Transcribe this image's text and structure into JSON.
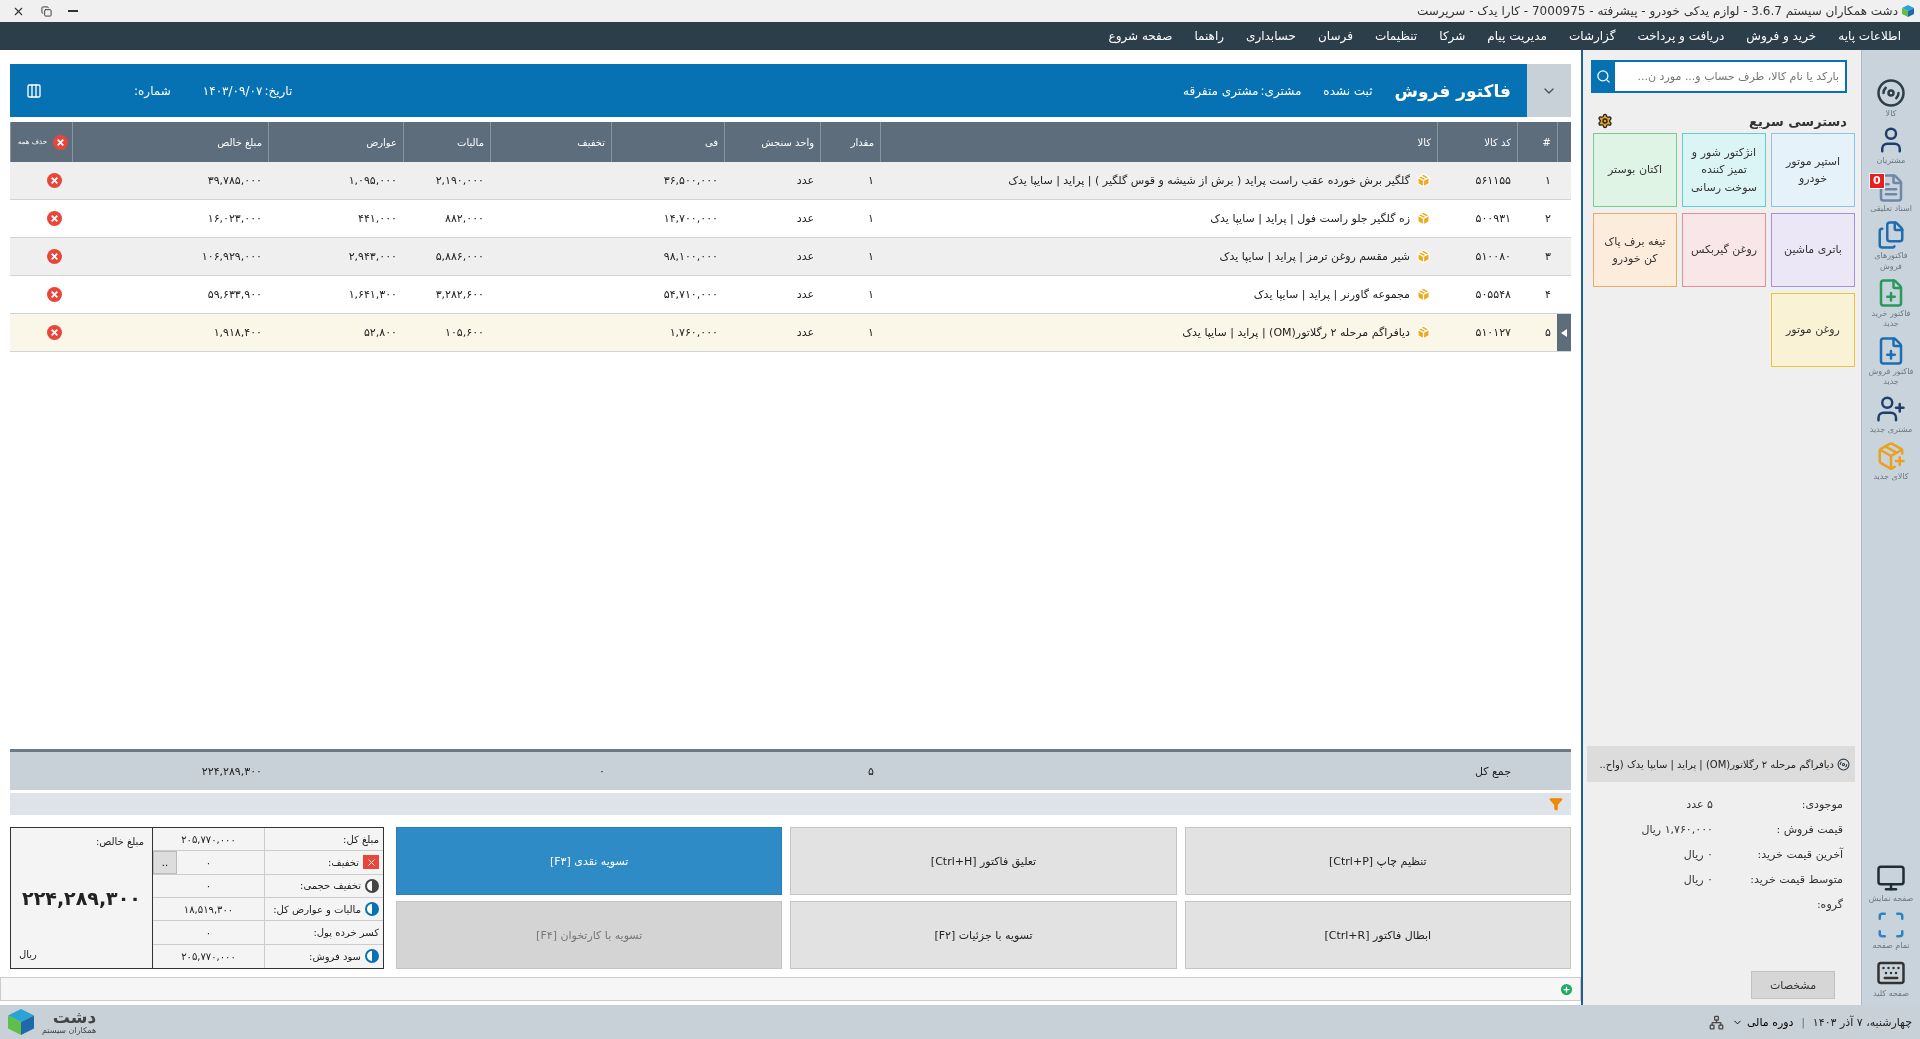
{
  "window": {
    "title": "دشت همکاران سیستم 3.6.7 - لوازم یدکی خودرو - پیشرفته - 7000975 - کارا یدک - سرپرست"
  },
  "menu": [
    "اطلاعات پایه",
    "خرید و فروش",
    "دریافت و پرداخت",
    "گزارشات",
    "مدیریت پیام",
    "شرکا",
    "تنظیمات",
    "فرسان",
    "حسابداری",
    "راهنما",
    "صفحه شروع"
  ],
  "invoice": {
    "title": "فاکتور فروش",
    "status": "ثبت نشده",
    "customer_label": "مشتری:",
    "customer": "مشتری متفرقه",
    "date_label": "تاریخ:",
    "date": "۱۴۰۳/۰۹/۰۷",
    "number_label": "شماره:"
  },
  "table": {
    "columns": [
      "#",
      "کد کالا",
      "کالا",
      "مقدار",
      "واحد سنجش",
      "فی",
      "تخفیف",
      "مالیات",
      "عوارض",
      "مبلغ خالص"
    ],
    "delete_all": "حذف همه",
    "rows": [
      {
        "num": "۱",
        "code": "۵۶۱۱۵۵",
        "item": "گلگیر برش خورده عقب راست پراید ( برش از شیشه و قوس گلگیر ) | پراید | سایپا یدک",
        "qty": "۱",
        "unit": "عدد",
        "price": "۳۶,۵۰۰,۰۰۰",
        "tax": "۲,۱۹۰,۰۰۰",
        "duty": "۱,۰۹۵,۰۰۰",
        "net": "۳۹,۷۸۵,۰۰۰",
        "selected": false
      },
      {
        "num": "۲",
        "code": "۵۰۰۹۳۱",
        "item": "زه گلگیر جلو راست فول | پراید | سایپا یدک",
        "qty": "۱",
        "unit": "عدد",
        "price": "۱۴,۷۰۰,۰۰۰",
        "tax": "۸۸۲,۰۰۰",
        "duty": "۴۴۱,۰۰۰",
        "net": "۱۶,۰۲۳,۰۰۰",
        "selected": false
      },
      {
        "num": "۳",
        "code": "۵۱۰۰۸۰",
        "item": "شیر مقسم روغن ترمز | پراید | سایپا یدک",
        "qty": "۱",
        "unit": "عدد",
        "price": "۹۸,۱۰۰,۰۰۰",
        "tax": "۵,۸۸۶,۰۰۰",
        "duty": "۲,۹۴۳,۰۰۰",
        "net": "۱۰۶,۹۲۹,۰۰۰",
        "selected": false
      },
      {
        "num": "۴",
        "code": "۵۰۵۵۴۸",
        "item": "مجموعه گاورنر | پراید | سایپا یدک",
        "qty": "۱",
        "unit": "عدد",
        "price": "۵۴,۷۱۰,۰۰۰",
        "tax": "۳,۲۸۲,۶۰۰",
        "duty": "۱,۶۴۱,۳۰۰",
        "net": "۵۹,۶۳۳,۹۰۰",
        "selected": false
      },
      {
        "num": "۵",
        "code": "۵۱۰۱۲۷",
        "item": "دیافراگم مرحله ۲ رگلاتور(OM) | پراید | سایپا یدک",
        "qty": "۱",
        "unit": "عدد",
        "price": "۱,۷۶۰,۰۰۰",
        "tax": "۱۰۵,۶۰۰",
        "duty": "۵۲,۸۰۰",
        "net": "۱,۹۱۸,۴۰۰",
        "selected": true
      }
    ],
    "totals": {
      "label": "جمع کل",
      "qty": "۵",
      "discount": "۰",
      "net": "۲۲۴,۲۸۹,۳۰۰"
    }
  },
  "summary": {
    "net_label": "مبلغ خالص:",
    "net": "۲۲۴,۲۸۹,۳۰۰",
    "currency": "ریال",
    "lines": [
      {
        "kind": "plain",
        "label": "مبلغ کل:",
        "value": "۲۰۵,۷۷۰,۰۰۰"
      },
      {
        "kind": "discount",
        "label": "تخفیف:",
        "value": "۰",
        "button": ".."
      },
      {
        "kind": "toggle",
        "on": false,
        "label": "تخفیف حجمی:",
        "value": "۰"
      },
      {
        "kind": "toggle",
        "on": true,
        "label": "مالیات و عوارض کل:",
        "value": "۱۸,۵۱۹,۳۰۰"
      },
      {
        "kind": "plain",
        "label": "کسر خرده پول:",
        "value": "۰"
      },
      {
        "kind": "toggle",
        "on": true,
        "label": "سود فروش:",
        "value": "۲۰۵,۷۷۰,۰۰۰"
      }
    ]
  },
  "actions": [
    {
      "label": "تنظیم چاپ [Ctrl+P]",
      "kind": "normal",
      "disabled": false
    },
    {
      "label": "تعلیق فاکتور [Ctrl+H]",
      "kind": "normal",
      "disabled": false
    },
    {
      "label": "تسویه نقدی [F۳]",
      "kind": "primary",
      "disabled": false
    },
    {
      "label": "ابطال فاکتور [Ctrl+R]",
      "kind": "normal",
      "disabled": false
    },
    {
      "label": "تسویه با جزئیات [F۲]",
      "kind": "normal",
      "disabled": false
    },
    {
      "label": "تسویه با کارتخوان [F۴]",
      "kind": "normal",
      "disabled": true
    }
  ],
  "search": {
    "placeholder": "بارکد یا نام کالا، طرف حساب و... مورد ن..."
  },
  "quick_access": {
    "title": "دسترسی سریع",
    "tiles": [
      {
        "label": "استپر موتور خودرو",
        "color": "#8cc4e8"
      },
      {
        "label": "انژکتور شور و تمیز کننده سوخت رسانی",
        "color": "#5ccfd6"
      },
      {
        "label": "اکتان بوستر",
        "color": "#72cf8e"
      },
      {
        "label": "باتری ماشین",
        "color": "#a890d8"
      },
      {
        "label": "روغن گیربکس",
        "color": "#e28f9b"
      },
      {
        "label": "تیغه برف پاک کن خودرو",
        "color": "#f0a862"
      },
      {
        "label": "روغن موتور",
        "color": "#e6c63e"
      }
    ]
  },
  "product_info": {
    "title": "دیافراگم مرحله ۲ رگلاتور(OM) | پراید | سایپا یدک (واح..",
    "fields": [
      {
        "label": "موجودی:",
        "value": "۵ عدد"
      },
      {
        "label": "قیمت فروش :",
        "value": "۱,۷۶۰,۰۰۰ ریال"
      },
      {
        "label": "آخرین قیمت خرید:",
        "value": "۰ ریال"
      },
      {
        "label": "متوسط قیمت خرید:",
        "value": "۰ ریال"
      },
      {
        "label": "گروه:"
      }
    ],
    "button": "مشخصات"
  },
  "sidebar": {
    "items": [
      {
        "kind": "wheel",
        "label": "کالا"
      },
      {
        "kind": "customers",
        "label": "مشتریان"
      },
      {
        "kind": "suspended",
        "label": "اسناد تعلیقی",
        "badge": "0"
      },
      {
        "kind": "sales_invoices",
        "label": "فاکتورهای فروش"
      },
      {
        "kind": "new_purchase",
        "label": "فاکتور خرید جدید"
      },
      {
        "kind": "new_sale",
        "label": "فاکتور فروش جدید"
      },
      {
        "kind": "new_customer",
        "label": "مشتری جدید"
      },
      {
        "kind": "new_product",
        "label": "کالای جدید"
      }
    ],
    "bottom_items": [
      {
        "kind": "display",
        "label": "صفحه نمایش"
      },
      {
        "kind": "fullscreen",
        "label": "تمام صفحه"
      },
      {
        "kind": "keyboard",
        "label": "صفحه کلید"
      }
    ]
  },
  "status_bar": {
    "date": "چهارشنبه، ۷ آذر ۱۴۰۳",
    "separator": "|",
    "period": "دوره مالی"
  },
  "logo": {
    "name": "دشت",
    "tagline": "همکاران سیستم"
  }
}
